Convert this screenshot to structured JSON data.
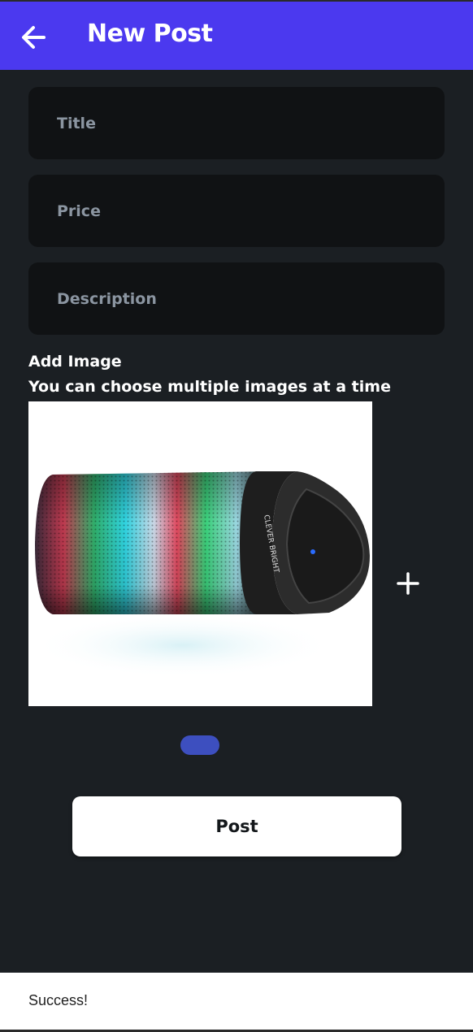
{
  "app_bar": {
    "title": "New Post",
    "back_icon": "arrow-left-icon",
    "background_color": "#4b39ef"
  },
  "form": {
    "title_placeholder": "Title",
    "price_placeholder": "Price",
    "description_placeholder": "Description",
    "title_value": "",
    "price_value": "",
    "description_value": ""
  },
  "images": {
    "label": "Add Image",
    "hint": "You can choose multiple images at a time",
    "add_icon": "plus-icon",
    "selected_count": 1,
    "product_brand_text": "CLEVER BRIGHT"
  },
  "actions": {
    "post_label": "Post"
  },
  "snackbar": {
    "message": "Success!"
  }
}
